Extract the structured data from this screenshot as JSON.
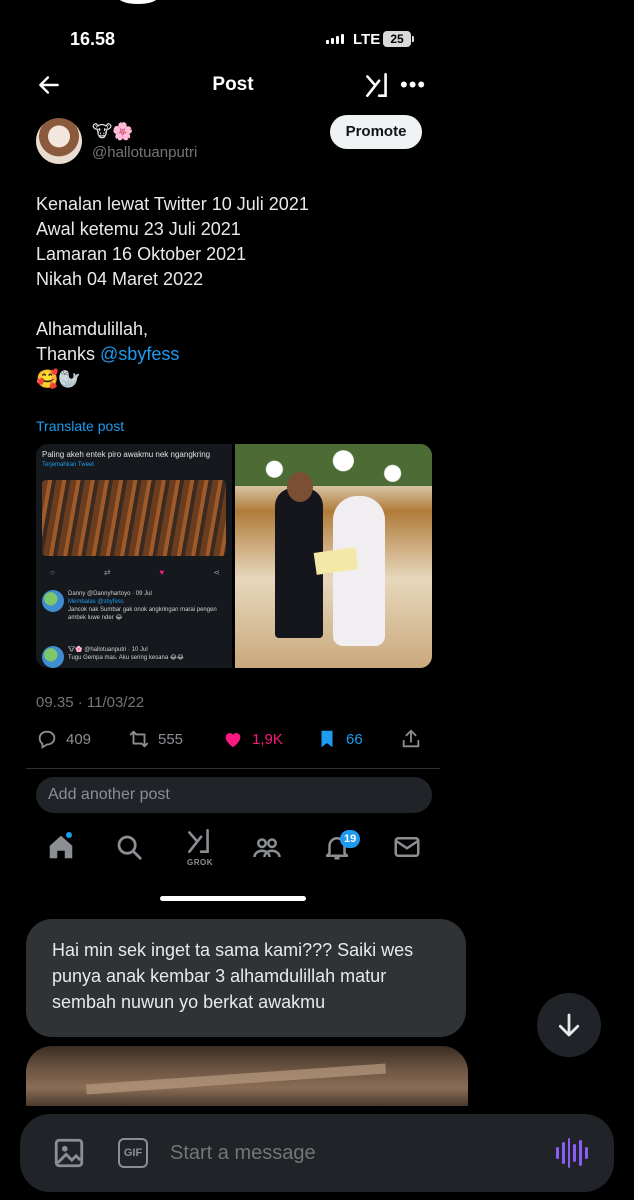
{
  "status": {
    "time": "16.58",
    "network": "LTE",
    "battery": "25"
  },
  "post_header": {
    "title": "Post"
  },
  "author": {
    "emojis": "🐮🌸",
    "handle": "@hallotuanputri"
  },
  "promote_label": "Promote",
  "tweet": {
    "lines": [
      "Kenalan lewat Twitter 10 Juli 2021",
      "Awal ketemu 23 Juli 2021",
      "Lamaran 16 Oktober 2021",
      "Nikah 04 Maret 2022",
      "",
      "Alhamdulillah,"
    ],
    "thanks_prefix": "Thanks ",
    "mention": "@sbyfess",
    "emoji_line": "🥰🦭"
  },
  "translate_label": "Translate post",
  "media": {
    "quoted_text": "Paling akeh entek piro awakmu nek ngangkring",
    "quoted_translate": "Terjemahkan Tweet",
    "reply1": {
      "author": "Danny @Dannyhartoyo · 09 Jul",
      "replying": "Membalas @sbyfess",
      "text": "Jancok nak Sumbar gak onok angkringan marai pengen ambek luwe nder 😂"
    },
    "reply2": {
      "author": "🐮🌸 @hallotuanputri · 10 Jul",
      "text": "Tugu Gempa mas. Aku sering kesana 😂😂"
    }
  },
  "timestamp": "09.35 · 11/03/22",
  "stats": {
    "replies": "409",
    "reposts": "555",
    "likes": "1,9K",
    "bookmarks": "66"
  },
  "colors": {
    "like": "#f91880",
    "bookmark": "#1d9bf0",
    "accent": "#1d9bf0",
    "voice": "#8b5cf6"
  },
  "add_post_placeholder": "Add another post",
  "bottom_nav": {
    "grok_label": "GROK",
    "notifications_count": "19"
  },
  "dm": {
    "message": "Hai min sek inget ta sama kami??? Saiki wes punya anak kembar 3 alhamdulillah matur sembah nuwun yo berkat awakmu",
    "composer_placeholder": "Start a message",
    "gif_label": "GIF"
  },
  "icons": [
    "back-arrow-icon",
    "grok-icon",
    "more-icon",
    "reply-icon",
    "repost-icon",
    "heart-icon",
    "bookmark-icon",
    "share-icon",
    "home-icon",
    "search-icon",
    "communities-icon",
    "bell-icon",
    "mail-icon",
    "arrow-down-icon",
    "image-icon",
    "gif-icon",
    "voice-icon"
  ]
}
